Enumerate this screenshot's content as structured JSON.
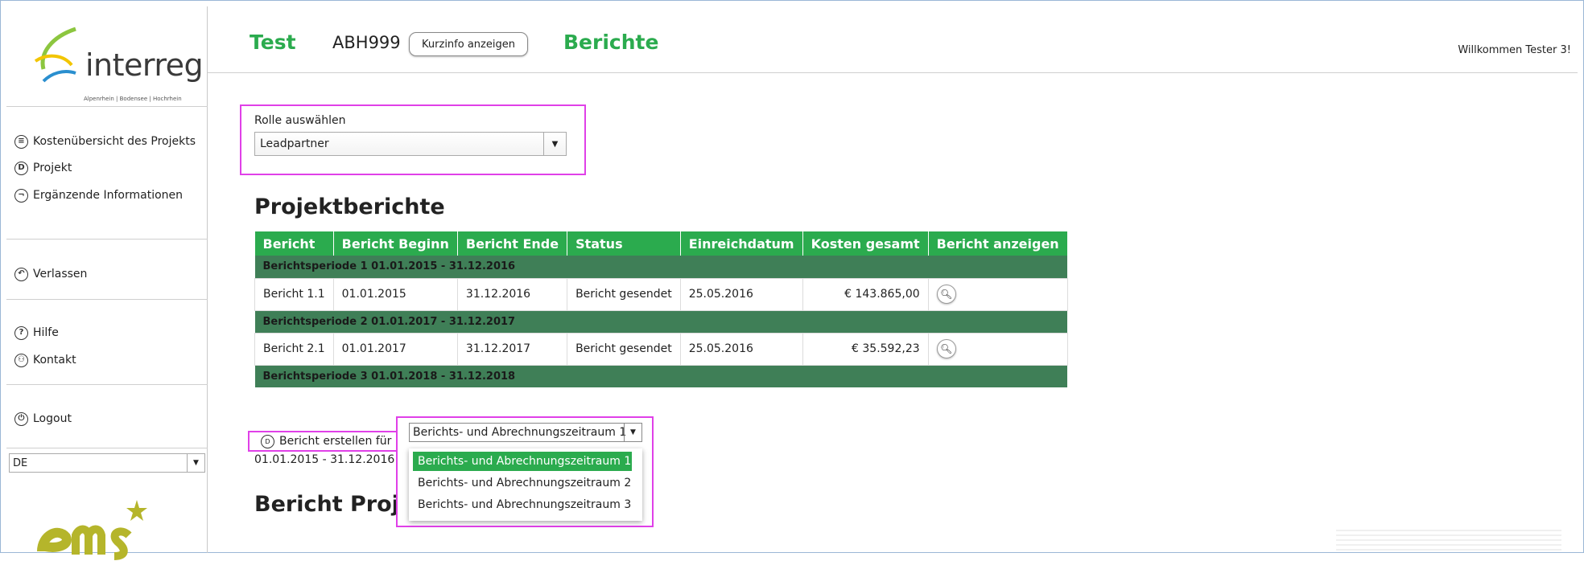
{
  "header": {
    "title": "Test",
    "project_code": "ABH999",
    "kurzinfo_label": "Kurzinfo anzeigen",
    "section": "Berichte",
    "welcome": "Willkommen Tester 3!"
  },
  "logo": {
    "text": "interreg",
    "subtitle": "Alpenrhein | Bodensee | Hochrhein"
  },
  "sidebar": {
    "items": [
      {
        "label": "Kostenübersicht des Projekts",
        "icon": "list-icon"
      },
      {
        "label": "Projekt",
        "icon": "document-icon"
      },
      {
        "label": "Ergänzende Informationen",
        "icon": "info-icon"
      },
      {
        "label": "Verlassen",
        "icon": "back-arrow-icon"
      },
      {
        "label": "Hilfe",
        "icon": "question-icon"
      },
      {
        "label": "Kontakt",
        "icon": "person-icon"
      },
      {
        "label": "Logout",
        "icon": "power-icon"
      }
    ],
    "language": "DE"
  },
  "role": {
    "label": "Rolle auswählen",
    "value": "Leadpartner"
  },
  "reports": {
    "title": "Projektberichte",
    "columns": [
      "Bericht",
      "Bericht Beginn",
      "Bericht Ende",
      "Status",
      "Einreichdatum",
      "Kosten gesamt",
      "Bericht anzeigen"
    ],
    "periods": [
      {
        "label": "Berichtsperiode 1 01.01.2015 - 31.12.2016",
        "row": {
          "bericht": "Bericht 1.1",
          "beginn": "01.01.2015",
          "ende": "31.12.2016",
          "status": "Bericht gesendet",
          "datum": "25.05.2016",
          "kosten": "€ 143.865,00"
        }
      },
      {
        "label": "Berichtsperiode 2 01.01.2017 - 31.12.2017",
        "row": {
          "bericht": "Bericht 2.1",
          "beginn": "01.01.2017",
          "ende": "31.12.2017",
          "status": "Bericht gesendet",
          "datum": "25.05.2016",
          "kosten": "€ 35.592,23"
        }
      },
      {
        "label": "Berichtsperiode 3 01.01.2018 - 31.12.2018"
      }
    ]
  },
  "create": {
    "label": "Bericht erstellen für",
    "range": "01.01.2015 - 31.12.2016",
    "selected": "Berichts- und Abrechnungszeitraum 1",
    "options": [
      "Berichts- und Abrechnungszeitraum 1",
      "Berichts- und Abrechnungszeitraum 2",
      "Berichts- und Abrechnungszeitraum 3"
    ]
  },
  "bericht_projekt_title": "Bericht Projekt",
  "colors": {
    "accent": "#2bab4e",
    "period_row": "#3f7f57",
    "highlight": "#e040e8"
  }
}
